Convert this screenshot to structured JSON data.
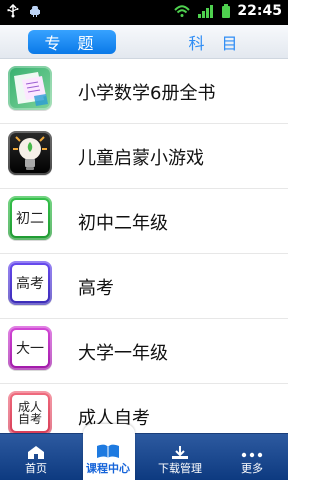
{
  "status_bar": {
    "time": "22:45",
    "icons": [
      "usb-icon",
      "android-icon",
      "wifi-icon",
      "signal-icon",
      "battery-icon"
    ]
  },
  "tabs": {
    "topics_label": "专 题",
    "subjects_label": "科 目"
  },
  "list": {
    "items": [
      {
        "label": "小学数学6册全书",
        "icon": "math-book-icon"
      },
      {
        "label": "儿童启蒙小游戏",
        "icon": "lightbulb-icon"
      },
      {
        "label": "初中二年级",
        "icon_text": "初二",
        "icon": "junior-high-grade2-icon"
      },
      {
        "label": "高考",
        "icon_text": "高考",
        "icon": "gaokao-icon"
      },
      {
        "label": "大学一年级",
        "icon_text": "大一",
        "icon": "college-year1-icon"
      },
      {
        "label": "成人自考",
        "icon_text": "成人\n自考",
        "icon": "adult-self-study-icon"
      }
    ]
  },
  "bottom_nav": {
    "items": [
      {
        "label": "首页",
        "icon": "home-icon"
      },
      {
        "label": "课程中心",
        "icon": "book-icon"
      },
      {
        "label": "下载管理",
        "icon": "download-icon"
      },
      {
        "label": "更多",
        "icon": "more-icon"
      }
    ]
  },
  "colors": {
    "accent": "#1a7ff0",
    "nav_bg": "#0d3a80"
  }
}
